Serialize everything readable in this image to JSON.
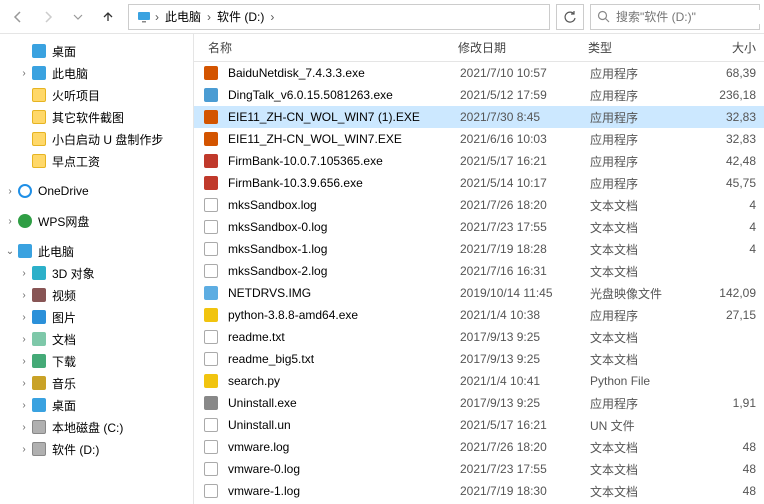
{
  "toolbar": {
    "breadcrumb": [
      "此电脑",
      "软件 (D:)"
    ],
    "search_placeholder": "搜索\"软件 (D:)\""
  },
  "columns": {
    "name": "名称",
    "date": "修改日期",
    "type": "类型",
    "size": "大小"
  },
  "sidebar": [
    {
      "label": "桌面",
      "icon": "monitor",
      "depth": 1,
      "tw": ""
    },
    {
      "label": "此电脑",
      "icon": "monitor",
      "depth": 1,
      "tw": "›"
    },
    {
      "label": "火听项目",
      "icon": "folder",
      "depth": 1,
      "tw": ""
    },
    {
      "label": "其它软件截图",
      "icon": "folder",
      "depth": 1,
      "tw": ""
    },
    {
      "label": "小白启动 U 盘制作步",
      "icon": "folder",
      "depth": 1,
      "tw": ""
    },
    {
      "label": "早点工资",
      "icon": "folder",
      "depth": 1,
      "tw": ""
    },
    {
      "label": "",
      "icon": "",
      "depth": 0,
      "tw": "",
      "spacer": true
    },
    {
      "label": "OneDrive",
      "icon": "cloud",
      "depth": 0,
      "tw": "›"
    },
    {
      "label": "",
      "icon": "",
      "depth": 0,
      "tw": "",
      "spacer": true
    },
    {
      "label": "WPS网盘",
      "icon": "wps",
      "depth": 0,
      "tw": "›"
    },
    {
      "label": "",
      "icon": "",
      "depth": 0,
      "tw": "",
      "spacer": true
    },
    {
      "label": "此电脑",
      "icon": "monitor",
      "depth": 0,
      "tw": "⌄"
    },
    {
      "label": "3D 对象",
      "icon": "3d",
      "depth": 1,
      "tw": "›"
    },
    {
      "label": "视频",
      "icon": "video",
      "depth": 1,
      "tw": "›"
    },
    {
      "label": "图片",
      "icon": "pic",
      "depth": 1,
      "tw": "›"
    },
    {
      "label": "文档",
      "icon": "doc",
      "depth": 1,
      "tw": "›"
    },
    {
      "label": "下载",
      "icon": "dl",
      "depth": 1,
      "tw": "›"
    },
    {
      "label": "音乐",
      "icon": "music",
      "depth": 1,
      "tw": "›"
    },
    {
      "label": "桌面",
      "icon": "monitor",
      "depth": 1,
      "tw": "›"
    },
    {
      "label": "本地磁盘 (C:)",
      "icon": "drive",
      "depth": 1,
      "tw": "›"
    },
    {
      "label": "软件 (D:)",
      "icon": "drive",
      "depth": 1,
      "tw": "›"
    }
  ],
  "files": [
    {
      "name": "BaiduNetdisk_7.4.3.3.exe",
      "date": "2021/7/10 10:57",
      "type": "应用程序",
      "size": "68,39",
      "icon": "exe3"
    },
    {
      "name": "DingTalk_v6.0.15.5081263.exe",
      "date": "2021/5/12 17:59",
      "type": "应用程序",
      "size": "236,18",
      "icon": "exe"
    },
    {
      "name": "EIE11_ZH-CN_WOL_WIN7 (1).EXE",
      "date": "2021/7/30 8:45",
      "type": "应用程序",
      "size": "32,83",
      "icon": "exe3",
      "selected": true
    },
    {
      "name": "EIE11_ZH-CN_WOL_WIN7.EXE",
      "date": "2021/6/16 10:03",
      "type": "应用程序",
      "size": "32,83",
      "icon": "exe3"
    },
    {
      "name": "FirmBank-10.0.7.105365.exe",
      "date": "2021/5/17 16:21",
      "type": "应用程序",
      "size": "42,48",
      "icon": "exe2"
    },
    {
      "name": "FirmBank-10.3.9.656.exe",
      "date": "2021/5/14 10:17",
      "type": "应用程序",
      "size": "45,75",
      "icon": "exe2"
    },
    {
      "name": "mksSandbox.log",
      "date": "2021/7/26 18:20",
      "type": "文本文档",
      "size": "4",
      "icon": "txt"
    },
    {
      "name": "mksSandbox-0.log",
      "date": "2021/7/23 17:55",
      "type": "文本文档",
      "size": "4",
      "icon": "txt"
    },
    {
      "name": "mksSandbox-1.log",
      "date": "2021/7/19 18:28",
      "type": "文本文档",
      "size": "4",
      "icon": "txt"
    },
    {
      "name": "mksSandbox-2.log",
      "date": "2021/7/16 16:31",
      "type": "文本文档",
      "size": "",
      "icon": "txt"
    },
    {
      "name": "NETDRVS.IMG",
      "date": "2019/10/14 11:45",
      "type": "光盘映像文件",
      "size": "142,09",
      "icon": "img"
    },
    {
      "name": "python-3.8.8-amd64.exe",
      "date": "2021/1/4 10:38",
      "type": "应用程序",
      "size": "27,15",
      "icon": "py"
    },
    {
      "name": "readme.txt",
      "date": "2017/9/13 9:25",
      "type": "文本文档",
      "size": "",
      "icon": "txt"
    },
    {
      "name": "readme_big5.txt",
      "date": "2017/9/13 9:25",
      "type": "文本文档",
      "size": "",
      "icon": "txt"
    },
    {
      "name": "search.py",
      "date": "2021/1/4 10:41",
      "type": "Python File",
      "size": "",
      "icon": "py"
    },
    {
      "name": "Uninstall.exe",
      "date": "2017/9/13 9:25",
      "type": "应用程序",
      "size": "1,91",
      "icon": "un"
    },
    {
      "name": "Uninstall.un",
      "date": "2021/5/17 16:21",
      "type": "UN 文件",
      "size": "",
      "icon": "txt"
    },
    {
      "name": "vmware.log",
      "date": "2021/7/26 18:20",
      "type": "文本文档",
      "size": "48",
      "icon": "txt"
    },
    {
      "name": "vmware-0.log",
      "date": "2021/7/23 17:55",
      "type": "文本文档",
      "size": "48",
      "icon": "txt"
    },
    {
      "name": "vmware-1.log",
      "date": "2021/7/19 18:30",
      "type": "文本文档",
      "size": "48",
      "icon": "txt"
    }
  ]
}
